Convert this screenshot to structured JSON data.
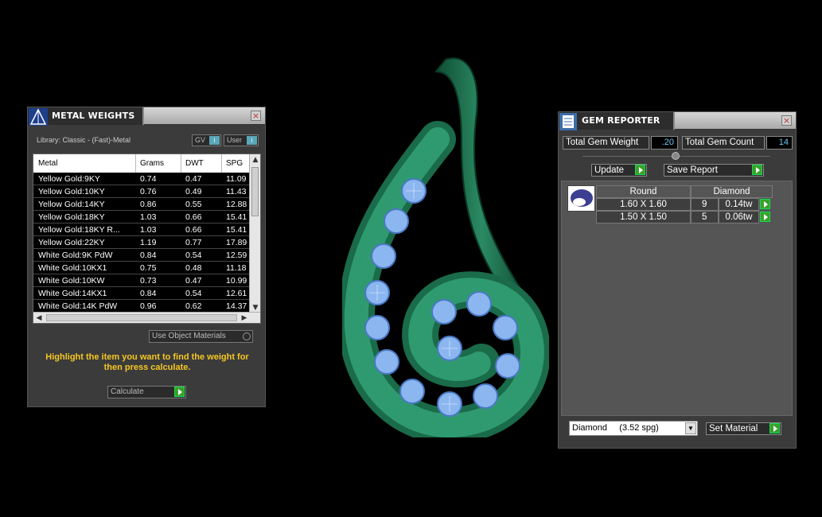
{
  "metal_panel": {
    "title": "METAL WEIGHTS",
    "library_label": "Library: Classic - (Fast)-Metal",
    "toggle_gv": "GV",
    "toggle_user": "User",
    "toggle_indicator": "i",
    "columns": [
      "Metal",
      "Grams",
      "DWT",
      "SPG"
    ],
    "rows": [
      [
        "Yellow Gold:9KY",
        "0.74",
        "0.47",
        "11.09"
      ],
      [
        "Yellow Gold:10KY",
        "0.76",
        "0.49",
        "11.43"
      ],
      [
        "Yellow Gold:14KY",
        "0.86",
        "0.55",
        "12.88"
      ],
      [
        "Yellow Gold:18KY",
        "1.03",
        "0.66",
        "15.41"
      ],
      [
        "Yellow Gold:18KY R...",
        "1.03",
        "0.66",
        "15.41"
      ],
      [
        "Yellow Gold:22KY",
        "1.19",
        "0.77",
        "17.89"
      ],
      [
        "White Gold:9K PdW",
        "0.84",
        "0.54",
        "12.59"
      ],
      [
        "White Gold:10KX1",
        "0.75",
        "0.48",
        "11.18"
      ],
      [
        "White Gold:10KW",
        "0.73",
        "0.47",
        "10.99"
      ],
      [
        "White Gold:14KX1",
        "0.84",
        "0.54",
        "12.61"
      ],
      [
        "White Gold:14K PdW",
        "0.96",
        "0.62",
        "14.37"
      ]
    ],
    "use_object_materials": "Use Object Materials",
    "hint": "Highlight the item you want to find the weight for then press calculate.",
    "calculate_label": "Calculate"
  },
  "gem_panel": {
    "title": "GEM REPORTER",
    "total_weight_label": "Total Gem Weight",
    "total_weight_value": ".20",
    "total_count_label": "Total Gem Count",
    "total_count_value": "14",
    "update_label": "Update",
    "save_report_label": "Save Report",
    "table_header": [
      "Round",
      "Diamond"
    ],
    "rows": [
      {
        "size": "1.60 X 1.60",
        "count": "9",
        "weight": "0.14tw"
      },
      {
        "size": "1.50 X 1.50",
        "count": "5",
        "weight": "0.06tw"
      }
    ],
    "material_select": "Diamond     (3.52 spg)",
    "set_material_label": "Set Material"
  },
  "colors": {
    "metal_green": "#1f6b4a",
    "gem_blue": "#7aa6e8",
    "hint_yellow": "#f5c722",
    "value_cyan": "#6cc9f0"
  }
}
